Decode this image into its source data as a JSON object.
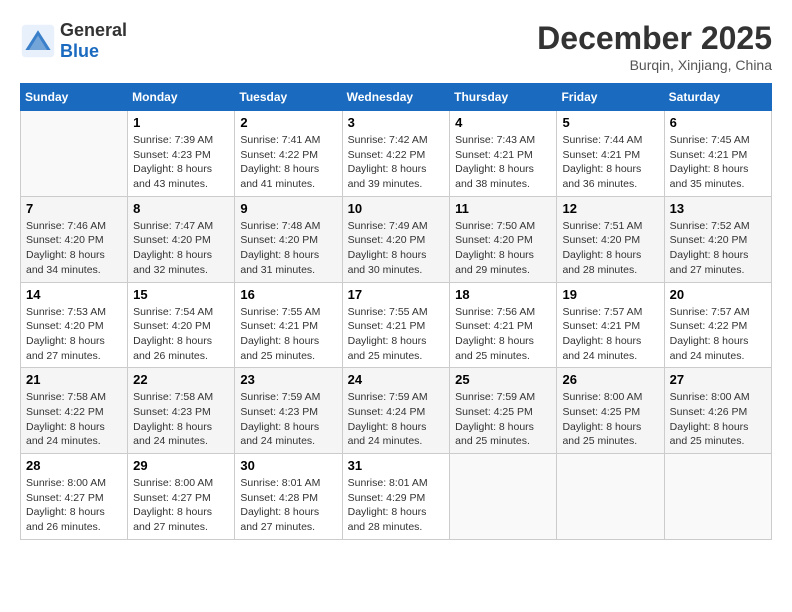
{
  "header": {
    "logo_general": "General",
    "logo_blue": "Blue",
    "month_title": "December 2025",
    "location": "Burqin, Xinjiang, China"
  },
  "days_of_week": [
    "Sunday",
    "Monday",
    "Tuesday",
    "Wednesday",
    "Thursday",
    "Friday",
    "Saturday"
  ],
  "weeks": [
    [
      {
        "day": "",
        "sunrise": "",
        "sunset": "",
        "daylight": "",
        "empty": true
      },
      {
        "day": "1",
        "sunrise": "Sunrise: 7:39 AM",
        "sunset": "Sunset: 4:23 PM",
        "daylight": "Daylight: 8 hours and 43 minutes."
      },
      {
        "day": "2",
        "sunrise": "Sunrise: 7:41 AM",
        "sunset": "Sunset: 4:22 PM",
        "daylight": "Daylight: 8 hours and 41 minutes."
      },
      {
        "day": "3",
        "sunrise": "Sunrise: 7:42 AM",
        "sunset": "Sunset: 4:22 PM",
        "daylight": "Daylight: 8 hours and 39 minutes."
      },
      {
        "day": "4",
        "sunrise": "Sunrise: 7:43 AM",
        "sunset": "Sunset: 4:21 PM",
        "daylight": "Daylight: 8 hours and 38 minutes."
      },
      {
        "day": "5",
        "sunrise": "Sunrise: 7:44 AM",
        "sunset": "Sunset: 4:21 PM",
        "daylight": "Daylight: 8 hours and 36 minutes."
      },
      {
        "day": "6",
        "sunrise": "Sunrise: 7:45 AM",
        "sunset": "Sunset: 4:21 PM",
        "daylight": "Daylight: 8 hours and 35 minutes."
      }
    ],
    [
      {
        "day": "7",
        "sunrise": "Sunrise: 7:46 AM",
        "sunset": "Sunset: 4:20 PM",
        "daylight": "Daylight: 8 hours and 34 minutes."
      },
      {
        "day": "8",
        "sunrise": "Sunrise: 7:47 AM",
        "sunset": "Sunset: 4:20 PM",
        "daylight": "Daylight: 8 hours and 32 minutes."
      },
      {
        "day": "9",
        "sunrise": "Sunrise: 7:48 AM",
        "sunset": "Sunset: 4:20 PM",
        "daylight": "Daylight: 8 hours and 31 minutes."
      },
      {
        "day": "10",
        "sunrise": "Sunrise: 7:49 AM",
        "sunset": "Sunset: 4:20 PM",
        "daylight": "Daylight: 8 hours and 30 minutes."
      },
      {
        "day": "11",
        "sunrise": "Sunrise: 7:50 AM",
        "sunset": "Sunset: 4:20 PM",
        "daylight": "Daylight: 8 hours and 29 minutes."
      },
      {
        "day": "12",
        "sunrise": "Sunrise: 7:51 AM",
        "sunset": "Sunset: 4:20 PM",
        "daylight": "Daylight: 8 hours and 28 minutes."
      },
      {
        "day": "13",
        "sunrise": "Sunrise: 7:52 AM",
        "sunset": "Sunset: 4:20 PM",
        "daylight": "Daylight: 8 hours and 27 minutes."
      }
    ],
    [
      {
        "day": "14",
        "sunrise": "Sunrise: 7:53 AM",
        "sunset": "Sunset: 4:20 PM",
        "daylight": "Daylight: 8 hours and 27 minutes."
      },
      {
        "day": "15",
        "sunrise": "Sunrise: 7:54 AM",
        "sunset": "Sunset: 4:20 PM",
        "daylight": "Daylight: 8 hours and 26 minutes."
      },
      {
        "day": "16",
        "sunrise": "Sunrise: 7:55 AM",
        "sunset": "Sunset: 4:21 PM",
        "daylight": "Daylight: 8 hours and 25 minutes."
      },
      {
        "day": "17",
        "sunrise": "Sunrise: 7:55 AM",
        "sunset": "Sunset: 4:21 PM",
        "daylight": "Daylight: 8 hours and 25 minutes."
      },
      {
        "day": "18",
        "sunrise": "Sunrise: 7:56 AM",
        "sunset": "Sunset: 4:21 PM",
        "daylight": "Daylight: 8 hours and 25 minutes."
      },
      {
        "day": "19",
        "sunrise": "Sunrise: 7:57 AM",
        "sunset": "Sunset: 4:21 PM",
        "daylight": "Daylight: 8 hours and 24 minutes."
      },
      {
        "day": "20",
        "sunrise": "Sunrise: 7:57 AM",
        "sunset": "Sunset: 4:22 PM",
        "daylight": "Daylight: 8 hours and 24 minutes."
      }
    ],
    [
      {
        "day": "21",
        "sunrise": "Sunrise: 7:58 AM",
        "sunset": "Sunset: 4:22 PM",
        "daylight": "Daylight: 8 hours and 24 minutes."
      },
      {
        "day": "22",
        "sunrise": "Sunrise: 7:58 AM",
        "sunset": "Sunset: 4:23 PM",
        "daylight": "Daylight: 8 hours and 24 minutes."
      },
      {
        "day": "23",
        "sunrise": "Sunrise: 7:59 AM",
        "sunset": "Sunset: 4:23 PM",
        "daylight": "Daylight: 8 hours and 24 minutes."
      },
      {
        "day": "24",
        "sunrise": "Sunrise: 7:59 AM",
        "sunset": "Sunset: 4:24 PM",
        "daylight": "Daylight: 8 hours and 24 minutes."
      },
      {
        "day": "25",
        "sunrise": "Sunrise: 7:59 AM",
        "sunset": "Sunset: 4:25 PM",
        "daylight": "Daylight: 8 hours and 25 minutes."
      },
      {
        "day": "26",
        "sunrise": "Sunrise: 8:00 AM",
        "sunset": "Sunset: 4:25 PM",
        "daylight": "Daylight: 8 hours and 25 minutes."
      },
      {
        "day": "27",
        "sunrise": "Sunrise: 8:00 AM",
        "sunset": "Sunset: 4:26 PM",
        "daylight": "Daylight: 8 hours and 25 minutes."
      }
    ],
    [
      {
        "day": "28",
        "sunrise": "Sunrise: 8:00 AM",
        "sunset": "Sunset: 4:27 PM",
        "daylight": "Daylight: 8 hours and 26 minutes."
      },
      {
        "day": "29",
        "sunrise": "Sunrise: 8:00 AM",
        "sunset": "Sunset: 4:27 PM",
        "daylight": "Daylight: 8 hours and 27 minutes."
      },
      {
        "day": "30",
        "sunrise": "Sunrise: 8:01 AM",
        "sunset": "Sunset: 4:28 PM",
        "daylight": "Daylight: 8 hours and 27 minutes."
      },
      {
        "day": "31",
        "sunrise": "Sunrise: 8:01 AM",
        "sunset": "Sunset: 4:29 PM",
        "daylight": "Daylight: 8 hours and 28 minutes."
      },
      {
        "day": "",
        "sunrise": "",
        "sunset": "",
        "daylight": "",
        "empty": true
      },
      {
        "day": "",
        "sunrise": "",
        "sunset": "",
        "daylight": "",
        "empty": true
      },
      {
        "day": "",
        "sunrise": "",
        "sunset": "",
        "daylight": "",
        "empty": true
      }
    ]
  ]
}
